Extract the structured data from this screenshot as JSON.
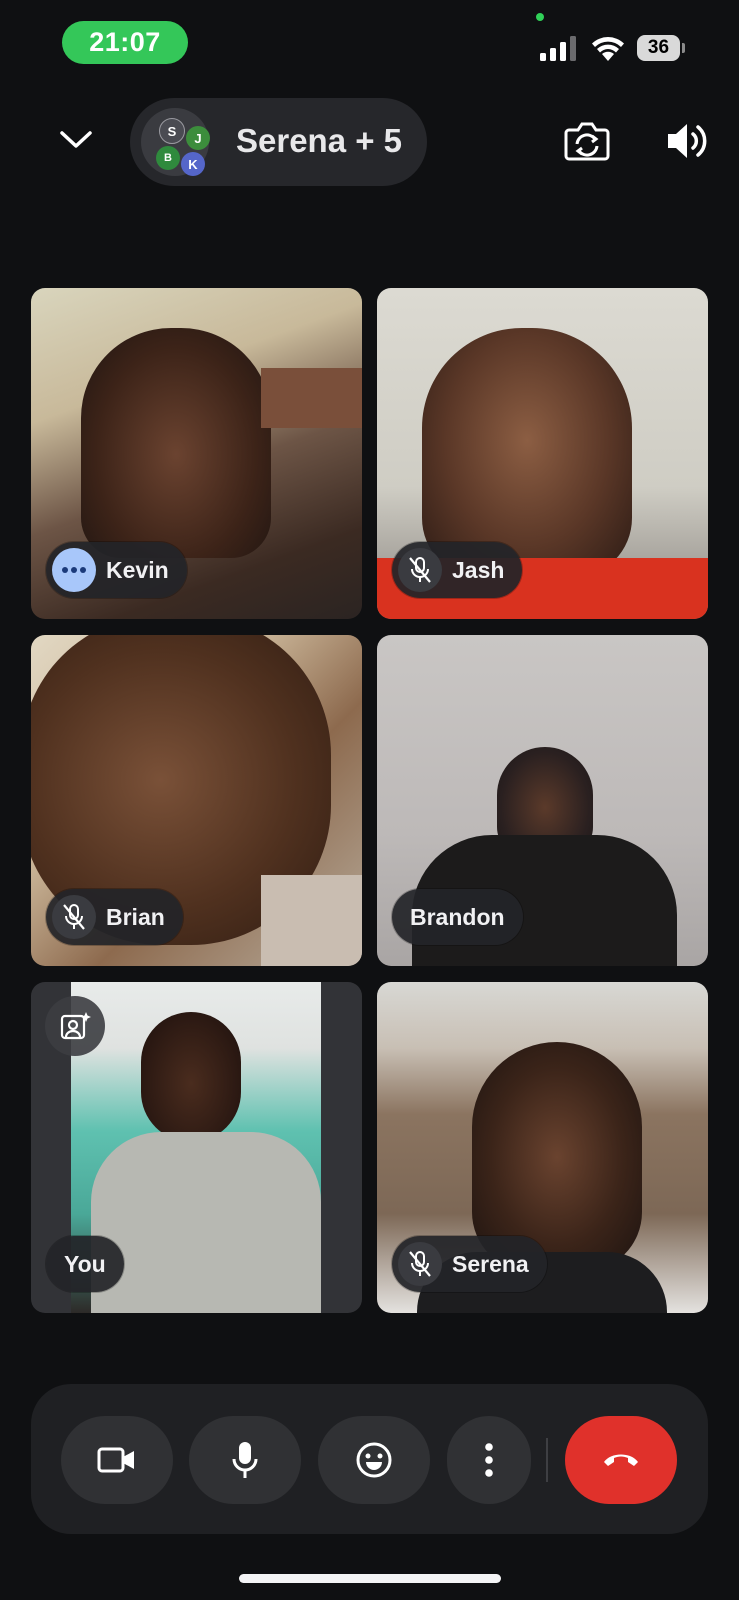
{
  "status_bar": {
    "time": "21:07",
    "battery_level": "36",
    "icons": [
      "cellular-signal-icon",
      "wifi-icon",
      "battery-icon"
    ],
    "time_pill_color": "#34c759"
  },
  "header": {
    "title": "Serena + 5",
    "avatars": [
      {
        "initial": "S",
        "color": "#4a4b52"
      },
      {
        "initial": "J",
        "color": "#3c8d3c"
      },
      {
        "initial": "B",
        "color": "#2f8a3d"
      },
      {
        "initial": "K",
        "color": "#5566c9"
      }
    ],
    "icons": [
      "chevron-down-icon",
      "flip-camera-icon",
      "speaker-icon"
    ]
  },
  "participants": [
    {
      "name": "Kevin",
      "status": "speaking",
      "status_icon": "more-dots-icon"
    },
    {
      "name": "Jash",
      "status": "muted",
      "status_icon": "mic-off-icon"
    },
    {
      "name": "Brian",
      "status": "muted",
      "status_icon": "mic-off-icon"
    },
    {
      "name": "Brandon",
      "status": "unmuted",
      "status_icon": ""
    },
    {
      "name": "You",
      "status": "self",
      "status_icon": "",
      "overlay_icon": "portrait-effects-icon"
    },
    {
      "name": "Serena",
      "status": "muted",
      "status_icon": "mic-off-icon"
    }
  ],
  "controls": {
    "items": [
      "camera-icon",
      "microphone-icon",
      "emoji-icon",
      "more-options-icon",
      "end-call-icon"
    ],
    "end_call_color": "#e0312b"
  }
}
